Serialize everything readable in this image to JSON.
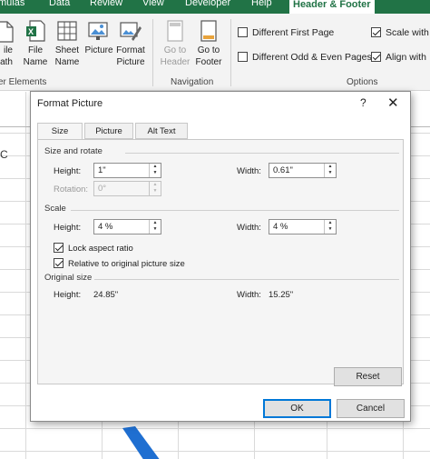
{
  "ribbon": {
    "tabs": [
      "mulas",
      "Data",
      "Review",
      "View",
      "Developer",
      "Help",
      "Header & Footer"
    ],
    "active_tab": "Header & Footer",
    "buttons": {
      "file_path": "ile\nath",
      "file_name": "File\nName",
      "sheet_name": "Sheet\nName",
      "picture": "Picture",
      "format_picture": "Format\nPicture",
      "go_to_header": "Go to\nHeader",
      "go_to_footer": "Go to\nFooter"
    },
    "groups": {
      "elements": "er Elements",
      "navigation": "Navigation",
      "options": "Options"
    },
    "options": {
      "different_first_page": "Different First Page",
      "different_odd_even": "Different Odd & Even Pages",
      "scale_with": "Scale with",
      "align_with": "Align with"
    },
    "options_checked": {
      "different_first_page": false,
      "different_odd_even": false,
      "scale_with": true,
      "align_with": true
    },
    "accent_color": "#217346"
  },
  "sheet": {
    "fragment_text": "C"
  },
  "dialog": {
    "title": "Format Picture",
    "help": "?",
    "close": "✕",
    "tabs": [
      "Size",
      "Picture",
      "Alt Text"
    ],
    "active_tab": "Size",
    "size_and_rotate": {
      "heading": "Size and rotate",
      "height_label": "Height:",
      "height_value": "1\"",
      "width_label": "Width:",
      "width_value": "0.61\"",
      "rotation_label": "Rotation:",
      "rotation_value": "0°"
    },
    "scale": {
      "heading": "Scale",
      "height_label": "Height:",
      "height_value": "4 %",
      "width_label": "Width:",
      "width_value": "4 %",
      "lock_aspect_ratio": "Lock aspect ratio",
      "relative_to_original": "Relative to original picture size",
      "lock_checked": true,
      "relative_checked": true
    },
    "original_size": {
      "heading": "Original size",
      "height_label": "Height:",
      "height_value": "24.85\"",
      "width_label": "Width:",
      "width_value": "15.25\""
    },
    "buttons": {
      "reset": "Reset",
      "ok": "OK",
      "cancel": "Cancel"
    },
    "focus_color": "#0078d7"
  },
  "icons": [
    "file-path-icon",
    "file-name-icon",
    "sheet-name-icon",
    "picture-icon",
    "format-picture-icon",
    "go-to-header-icon",
    "go-to-footer-icon",
    "checkbox-icon",
    "spin-up-icon",
    "spin-down-icon",
    "close-icon",
    "help-icon"
  ]
}
